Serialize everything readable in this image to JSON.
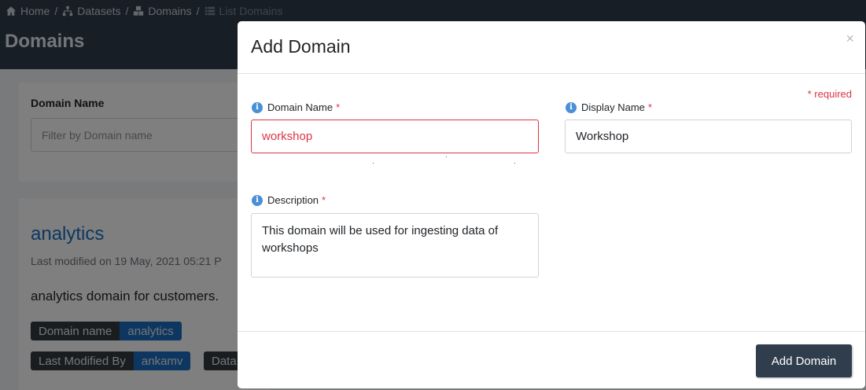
{
  "breadcrumb": [
    {
      "label": "Home",
      "icon": "home-icon"
    },
    {
      "label": "Datasets",
      "icon": "sitemap-icon"
    },
    {
      "label": "Domains",
      "icon": "cubes-icon"
    },
    {
      "label": "List Domains",
      "icon": "list-icon"
    }
  ],
  "breadcrumb_separator": "/",
  "page": {
    "title": "Domains",
    "filter": {
      "label": "Domain Name",
      "placeholder": "Filter by Domain name"
    },
    "result": {
      "name": "analytics",
      "last_modified": "Last modified on 19 May, 2021 05:21 P",
      "description": "analytics domain for customers.",
      "tags": [
        {
          "key": "Domain name",
          "value": "analytics"
        },
        {
          "key": "Last Modified By",
          "value": "ankamv"
        },
        {
          "key": "Data",
          "value": ""
        }
      ]
    }
  },
  "modal": {
    "title": "Add Domain",
    "close": "×",
    "required_note": "* required",
    "fields": {
      "domain_name": {
        "label": "Domain Name",
        "required": "*",
        "value": "workshop"
      },
      "display_name": {
        "label": "Display Name",
        "required": "*",
        "value": "Workshop"
      },
      "description": {
        "label": "Description",
        "required": "*",
        "value": "This domain will be used for ingesting data of workshops"
      }
    },
    "info_icon": "i",
    "submit_label": "Add Domain"
  },
  "colors": {
    "header_bg": "#2f3d4c",
    "link": "#1b6fc2",
    "required": "#dc3545",
    "info": "#4b8fd6",
    "button_bg": "#2f3d4c"
  }
}
